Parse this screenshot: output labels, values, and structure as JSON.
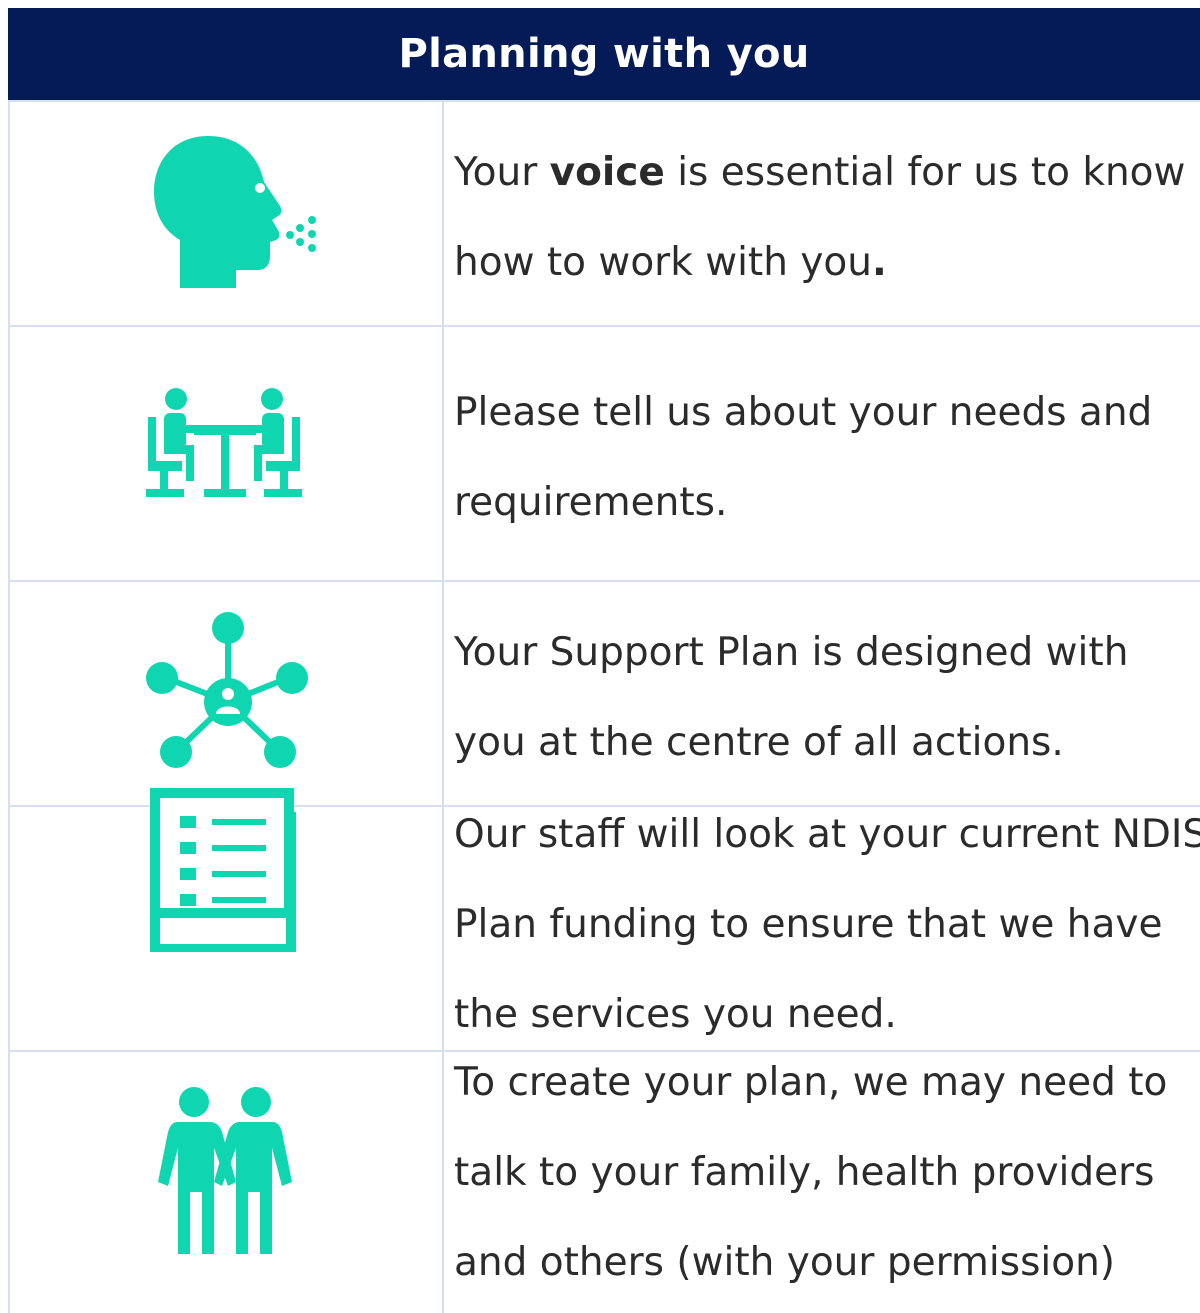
{
  "header": {
    "title": "Planning with you"
  },
  "rows": [
    {
      "icon": "speaking-head-icon",
      "lines": [
        {
          "before": "Your ",
          "bold": "voice",
          "after": " is essential for us to know"
        },
        {
          "text": "how to work with you",
          "bold_end": "."
        }
      ]
    },
    {
      "icon": "meeting-at-table-icon",
      "lines": [
        {
          "text": "Please tell us about your needs and"
        },
        {
          "text": "requirements."
        }
      ]
    },
    {
      "icon": "person-centred-network-icon",
      "lines": [
        {
          "text": "Your Support Plan is designed with"
        },
        {
          "text": "you at the centre of all actions."
        }
      ]
    },
    {
      "icon": "checklist-icon",
      "lines": [
        {
          "text": "Our staff will look at your current NDIS"
        },
        {
          "text": "Plan funding to ensure that we have"
        },
        {
          "text": "the services you need."
        }
      ]
    },
    {
      "icon": "two-people-holding-hands-icon",
      "lines": [
        {
          "text": "To create your plan, we may need to"
        },
        {
          "text": "talk to your family, health providers"
        },
        {
          "text": "and others (with your permission)"
        }
      ]
    }
  ],
  "colors": {
    "header_bg": "#041b57",
    "icon": "#0fd6b0",
    "grid": "#d6dff0",
    "text": "#2b2b2b"
  }
}
